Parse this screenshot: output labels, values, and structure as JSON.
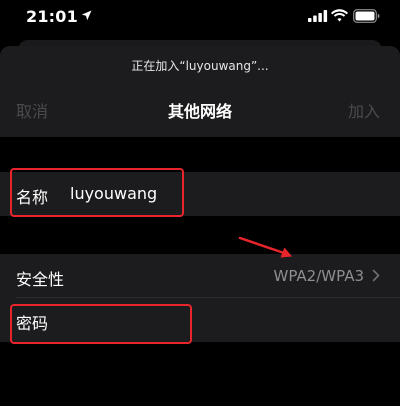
{
  "status_bar": {
    "time": "21:01"
  },
  "sheet": {
    "prompt": "正在加入“luyouwang”...",
    "nav": {
      "cancel_label": "取消",
      "title": "其他网络",
      "join_label": "加入"
    },
    "fields": {
      "name_label": "名称",
      "name_value": "luyouwang",
      "security_label": "安全性",
      "security_value": "WPA2/WPA3",
      "password_label": "密码"
    }
  },
  "colors": {
    "background": "#000000",
    "sheet": "#1c1c1e",
    "disabled_text": "#4a4a4e",
    "secondary_text": "#8e8e93",
    "annotation_red": "#e8252a"
  }
}
